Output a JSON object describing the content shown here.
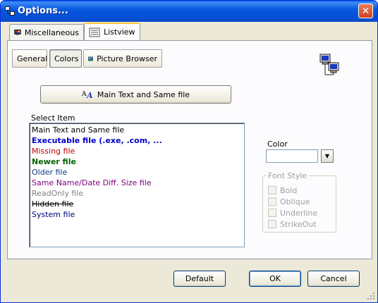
{
  "window": {
    "title": "Options..."
  },
  "outer_tabs": [
    {
      "label": "Miscellaneous",
      "icon": "settings-icon",
      "active": false
    },
    {
      "label": "Listview",
      "icon": "listview-icon",
      "active": true
    }
  ],
  "inner_tabs": [
    {
      "label": "General",
      "active": false
    },
    {
      "label": "Colors",
      "active": true
    },
    {
      "label": "Picture Browser",
      "icon": "picture-icon",
      "active": false
    }
  ],
  "main_button": {
    "label": "Main Text and Same file",
    "icon": "font-icon"
  },
  "select_item": {
    "label": "Select Item",
    "items": [
      {
        "label": "Main Text and Same file",
        "color": "#000000",
        "bold": false,
        "strike": false
      },
      {
        "label": "Executable file (.exe, .com, ...",
        "color": "#0000c8",
        "bold": true,
        "strike": false
      },
      {
        "label": "Missing file",
        "color": "#c00000",
        "bold": false,
        "strike": false
      },
      {
        "label": "Newer file",
        "color": "#006400",
        "bold": true,
        "strike": false
      },
      {
        "label": "Older file",
        "color": "#0a3c78",
        "bold": false,
        "strike": false
      },
      {
        "label": "Same Name/Date Diff. Size file",
        "color": "#800080",
        "bold": false,
        "strike": false
      },
      {
        "label": "ReadOnly file",
        "color": "#808080",
        "bold": false,
        "strike": false
      },
      {
        "label": "Hidden file",
        "color": "#000000",
        "bold": false,
        "strike": true
      },
      {
        "label": "System file",
        "color": "#000080",
        "bold": false,
        "strike": false
      }
    ]
  },
  "color": {
    "label": "Color",
    "value": ""
  },
  "font_style": {
    "legend": "Font Style",
    "options": [
      {
        "label": "Bold",
        "checked": false
      },
      {
        "label": "Oblique",
        "checked": false
      },
      {
        "label": "Underline",
        "checked": false
      },
      {
        "label": "StrikeOut",
        "checked": false
      }
    ]
  },
  "buttons": {
    "default": "Default",
    "ok": "OK",
    "cancel": "Cancel"
  }
}
